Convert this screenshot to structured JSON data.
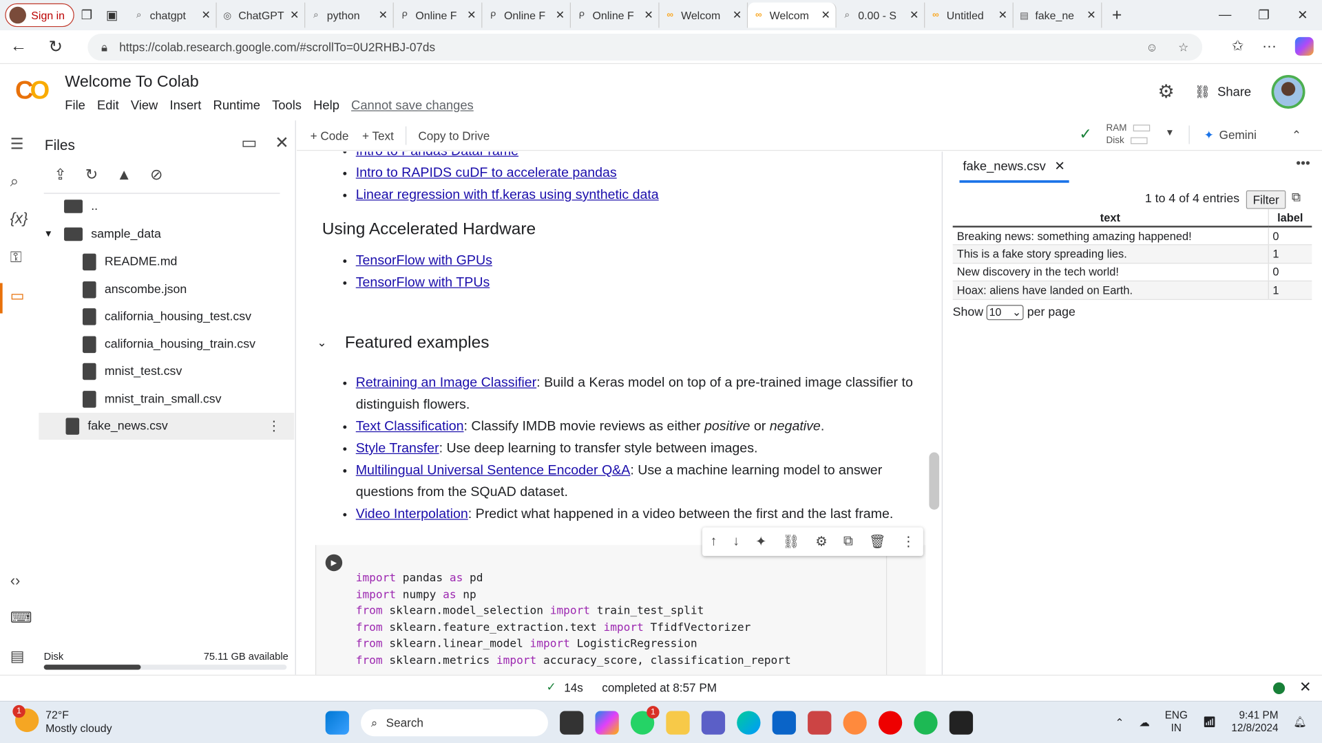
{
  "browser": {
    "signin_label": "Sign in",
    "tabs": [
      {
        "label": "chatgpt",
        "icon": "search-icon"
      },
      {
        "label": "ChatGPT",
        "icon": "chatgpt-icon"
      },
      {
        "label": "python",
        "icon": "search-icon"
      },
      {
        "label": "Online F",
        "icon": "online-icon"
      },
      {
        "label": "Online F",
        "icon": "online-icon"
      },
      {
        "label": "Online F",
        "icon": "online-icon"
      },
      {
        "label": "Welcom",
        "icon": "colab-icon"
      },
      {
        "label": "Welcom",
        "icon": "colab-icon",
        "active": true
      },
      {
        "label": "0.00 - S",
        "icon": "search-icon"
      },
      {
        "label": "Untitled",
        "icon": "colab-icon"
      },
      {
        "label": "fake_ne",
        "icon": "file-icon"
      }
    ],
    "url": "https://colab.research.google.com/#scrollTo=0U2RHBJ-07ds"
  },
  "colab": {
    "title": "Welcome To Colab",
    "menu": [
      "File",
      "Edit",
      "View",
      "Insert",
      "Runtime",
      "Tools",
      "Help"
    ],
    "cannot_save": "Cannot save changes",
    "share_label": "Share",
    "accent": "#e8710a"
  },
  "files": {
    "title": "Files",
    "parent": "..",
    "folder": "sample_data",
    "items": [
      "README.md",
      "anscombe.json",
      "california_housing_test.csv",
      "california_housing_train.csv",
      "mnist_test.csv",
      "mnist_train_small.csv"
    ],
    "selected": "fake_news.csv",
    "disk_label": "Disk",
    "disk_available": "75.11 GB available",
    "disk_used_fraction": 0.4
  },
  "toolbar": {
    "code_label": "+ Code",
    "text_label": "+ Text",
    "copy_label": "Copy to Drive",
    "ram_label": "RAM",
    "disk_label": "Disk",
    "gemini_label": "Gemini"
  },
  "notebook": {
    "top_links": [
      "Intro to Pandas DataFrame",
      "Intro to RAPIDS cuDF to accelerate pandas",
      "Linear regression with tf.keras using synthetic data"
    ],
    "accel_heading": "Using Accelerated Hardware",
    "accel_links": [
      "TensorFlow with GPUs",
      "TensorFlow with TPUs"
    ],
    "featured_heading": "Featured examples",
    "featured": [
      {
        "link": "Retraining an Image Classifier",
        "desc": ": Build a Keras model on top of a pre-trained image classifier to distinguish flowers."
      },
      {
        "link": "Text Classification",
        "desc_pre": ": Classify IMDB movie reviews as either ",
        "em1": "positive",
        "mid": " or ",
        "em2": "negative",
        "post": "."
      },
      {
        "link": "Style Transfer",
        "desc": ": Use deep learning to transfer style between images."
      },
      {
        "link": "Multilingual Universal Sentence Encoder Q&A",
        "desc": ": Use a machine learning model to answer questions from the SQuAD dataset."
      },
      {
        "link": "Video Interpolation",
        "desc": ": Predict what happened in a video between the first and the last frame."
      }
    ]
  },
  "right_panel": {
    "tab_label": "fake_news.csv",
    "entries": "1 to 4 of 4 entries",
    "filter_label": "Filter",
    "columns": [
      "text",
      "label"
    ],
    "rows": [
      [
        "Breaking news: something amazing happened!",
        "0"
      ],
      [
        "This is a fake story spreading lies.",
        "1"
      ],
      [
        "New discovery in the tech world!",
        "0"
      ],
      [
        "Hoax: aliens have landed on Earth.",
        "1"
      ]
    ],
    "show_label": "Show",
    "per_page_value": "10",
    "per_page_label": "per page"
  },
  "status": {
    "seconds": "14s",
    "completed": "completed at 8:57 PM"
  },
  "taskbar": {
    "temp": "72°F",
    "weather": "Mostly cloudy",
    "weather_badge": "1",
    "search_label": "Search",
    "whatsapp_badge": "1",
    "lang1": "ENG",
    "lang2": "IN",
    "time": "9:41 PM",
    "date": "12/8/2024"
  }
}
